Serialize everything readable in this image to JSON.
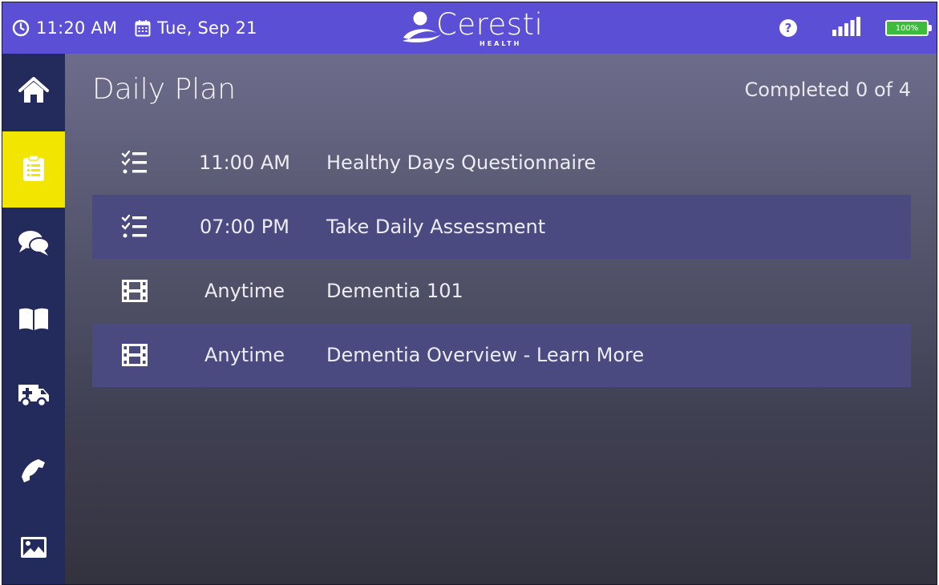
{
  "statusbar": {
    "time": "11:20 AM",
    "date": "Tue, Sep 21",
    "logo_text": "Ceresti",
    "logo_sub": "HEALTH",
    "battery": "100%",
    "icons": [
      "clock-icon",
      "calendar-icon",
      "help-icon",
      "signal-icon",
      "battery-icon"
    ]
  },
  "sidebar": {
    "items": [
      {
        "name": "home",
        "icon": "home-icon"
      },
      {
        "name": "daily-plan",
        "icon": "clipboard-icon",
        "active": true
      },
      {
        "name": "messages",
        "icon": "chat-bubbles-icon"
      },
      {
        "name": "library",
        "icon": "book-icon"
      },
      {
        "name": "emergency",
        "icon": "ambulance-icon"
      },
      {
        "name": "call",
        "icon": "phone-icon"
      },
      {
        "name": "photos",
        "icon": "image-icon"
      }
    ]
  },
  "main": {
    "title": "Daily Plan",
    "completed": "Completed 0 of 4",
    "items": [
      {
        "icon": "checklist-icon",
        "time": "11:00 AM",
        "title": "Healthy Days Questionnaire"
      },
      {
        "icon": "checklist-icon",
        "time": "07:00 PM",
        "title": "Take Daily Assessment"
      },
      {
        "icon": "film-icon",
        "time": "Anytime",
        "title": "Dementia 101"
      },
      {
        "icon": "film-icon",
        "time": "Anytime",
        "title": "Dementia Overview - Learn More"
      }
    ]
  },
  "colors": {
    "statusbar": "#5b4fd6",
    "sidebar": "#232a5c",
    "active_nav": "#f2e600",
    "row_highlight": "#4b4a80",
    "battery": "#3dbb3d"
  }
}
